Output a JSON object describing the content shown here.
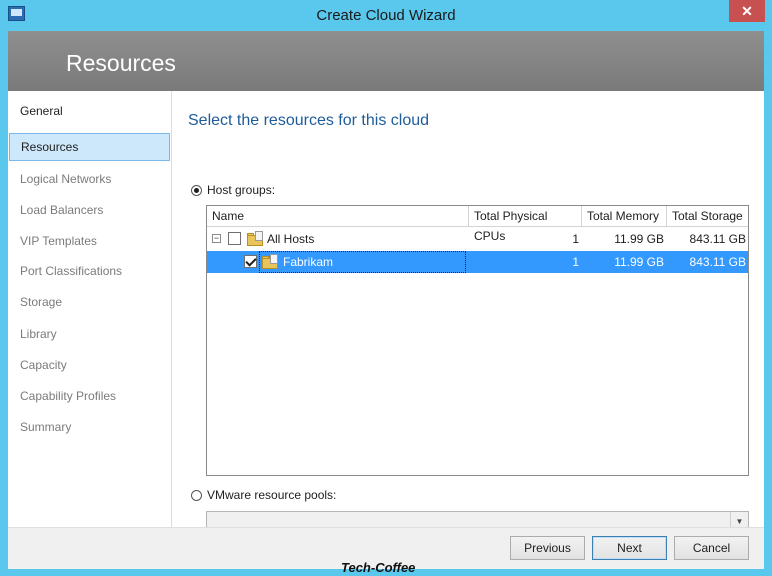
{
  "window": {
    "title": "Create Cloud Wizard",
    "close_glyph": "✕"
  },
  "banner": {
    "title": "Resources"
  },
  "nav": {
    "items": [
      {
        "label": "General",
        "state": "done"
      },
      {
        "label": "Resources",
        "state": "active"
      },
      {
        "label": "Logical Networks",
        "state": "pending"
      },
      {
        "label": "Load Balancers",
        "state": "pending"
      },
      {
        "label": "VIP Templates",
        "state": "pending"
      },
      {
        "label": "Port Classifications",
        "state": "pending"
      },
      {
        "label": "Storage",
        "state": "pending"
      },
      {
        "label": "Library",
        "state": "pending"
      },
      {
        "label": "Capacity",
        "state": "pending"
      },
      {
        "label": "Capability Profiles",
        "state": "pending"
      },
      {
        "label": "Summary",
        "state": "pending"
      }
    ]
  },
  "page": {
    "heading": "Select the resources for this cloud",
    "host_groups_option": {
      "label": "Host groups:",
      "selected": true
    },
    "vmware_option": {
      "label": "VMware resource pools:",
      "selected": false
    },
    "vmware_combo_value": ""
  },
  "grid": {
    "columns": [
      "Name",
      "Total Physical CPUs",
      "Total Memory",
      "Total Storage"
    ],
    "rows": [
      {
        "name": "All Hosts",
        "cpus": "1",
        "memory": "11.99 GB",
        "storage": "843.11 GB",
        "checked": false,
        "selected": false,
        "expander": "−"
      },
      {
        "name": "Fabrikam",
        "cpus": "1",
        "memory": "11.99 GB",
        "storage": "843.11 GB",
        "checked": true,
        "selected": true
      }
    ]
  },
  "buttons": {
    "previous": "Previous",
    "next": "Next",
    "cancel": "Cancel"
  },
  "watermark": "Tech-Coffee",
  "colors": {
    "title_bar": "#5ac8ec",
    "banner": "#858585",
    "heading": "#1f5c99",
    "selection": "#3399ff",
    "nav_active": "#cde8fb"
  }
}
